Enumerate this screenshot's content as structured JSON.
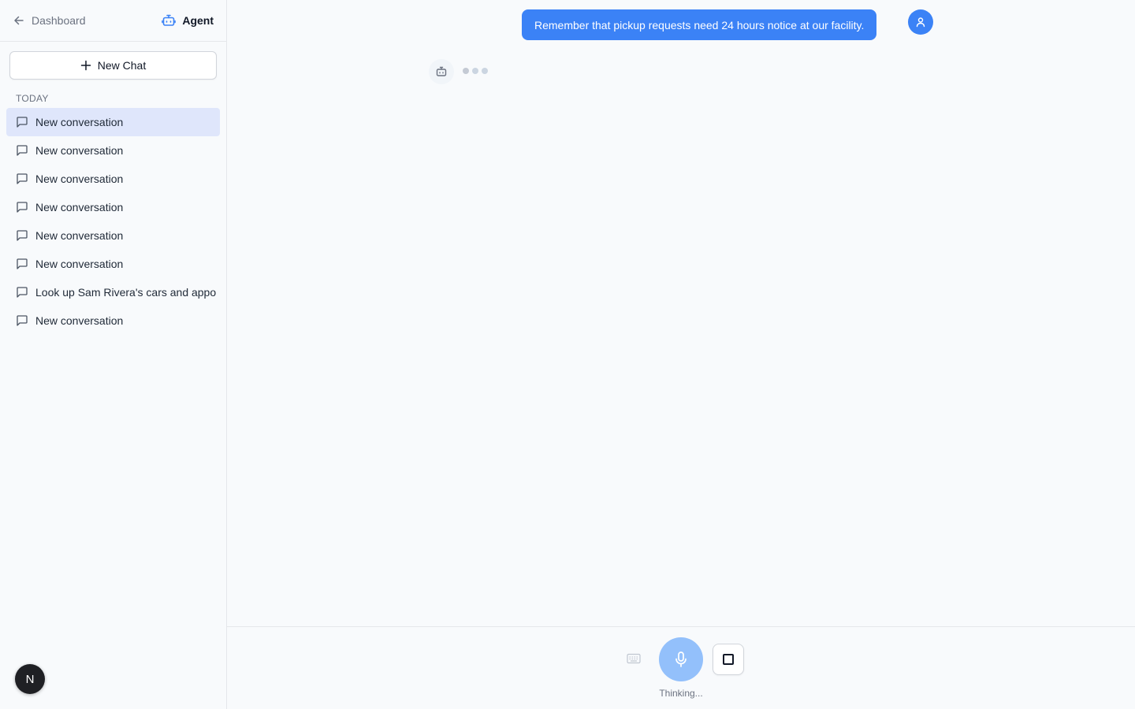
{
  "sidebar": {
    "back_label": "Dashboard",
    "agent_label": "Agent",
    "new_chat_label": "New Chat",
    "section_label": "TODAY",
    "conversations": [
      {
        "title": "New conversation",
        "active": true
      },
      {
        "title": "New conversation",
        "active": false
      },
      {
        "title": "New conversation",
        "active": false
      },
      {
        "title": "New conversation",
        "active": false
      },
      {
        "title": "New conversation",
        "active": false
      },
      {
        "title": "New conversation",
        "active": false
      },
      {
        "title": "Look up Sam Rivera's cars and appo",
        "active": false
      },
      {
        "title": "New conversation",
        "active": false
      }
    ],
    "user_initial": "N"
  },
  "chat": {
    "user_message": "Remember that pickup requests need 24 hours notice at our facility.",
    "assistant_state": "typing"
  },
  "controls": {
    "status": "Thinking..."
  },
  "colors": {
    "accent": "#3b82f6",
    "mic_active": "#93c0fb",
    "active_item_bg": "#dfe6fb"
  },
  "icons": {
    "back": "arrow-left-icon",
    "agent": "bot-icon",
    "new_chat": "plus-icon",
    "conversation": "message-square-icon",
    "user": "user-icon",
    "keyboard": "keyboard-icon",
    "mic": "mic-icon",
    "stop": "stop-square-icon"
  }
}
